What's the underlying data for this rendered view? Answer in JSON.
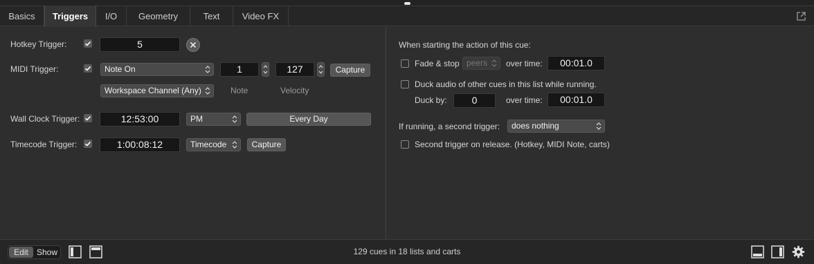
{
  "tabs": [
    {
      "label": "Basics",
      "active": false
    },
    {
      "label": "Triggers",
      "active": true
    },
    {
      "label": "I/O",
      "active": false
    },
    {
      "label": "Geometry",
      "active": false
    },
    {
      "label": "Text",
      "active": false
    },
    {
      "label": "Video FX",
      "active": false
    }
  ],
  "hotkey": {
    "label": "Hotkey Trigger:",
    "checked": true,
    "value": "5"
  },
  "midi": {
    "label": "MIDI Trigger:",
    "checked": true,
    "type": "Note On",
    "note": "1",
    "velocity": "127",
    "capture_label": "Capture",
    "channel": "Workspace Channel (Any)",
    "note_caption": "Note",
    "velocity_caption": "Velocity"
  },
  "wallclock": {
    "label": "Wall Clock Trigger:",
    "checked": true,
    "time": "12:53:00",
    "ampm": "PM",
    "repeat": "Every Day"
  },
  "timecode": {
    "label": "Timecode Trigger:",
    "checked": true,
    "value": "1:00:08:12",
    "format": "Timecode",
    "capture_label": "Capture"
  },
  "right": {
    "heading": "When starting the action of this cue:",
    "fade_stop": {
      "label": "Fade & stop",
      "checked": false,
      "target": "peers",
      "over_time_label": "over time:",
      "time": "00:01.0"
    },
    "duck": {
      "label": "Duck audio of other cues in this list while running.",
      "checked": false,
      "duck_by_label": "Duck by:",
      "duck_by": "0",
      "over_time_label": "over time:",
      "time": "00:01.0"
    },
    "second_trigger": {
      "label": "If running, a second trigger:",
      "value": "does nothing"
    },
    "release": {
      "label": "Second trigger on release. (Hotkey, MIDI Note, carts)",
      "checked": false
    }
  },
  "footer": {
    "edit_label": "Edit",
    "show_label": "Show",
    "status": "129 cues in 18 lists and carts"
  },
  "colors": {
    "checkbox": "#5a5a5a",
    "field_bg": "#161616",
    "background": "#2e2e2e"
  }
}
